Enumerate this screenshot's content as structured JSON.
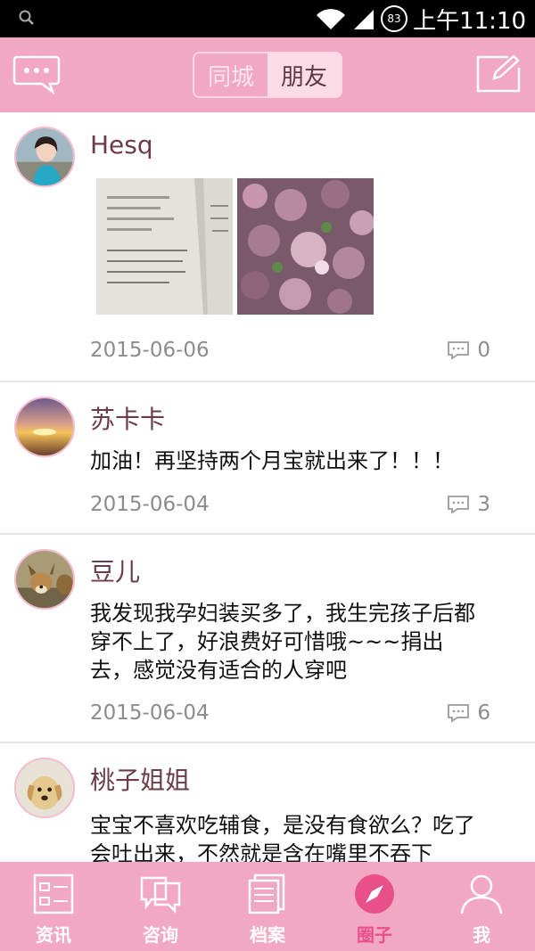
{
  "status_bar": {
    "battery": "83",
    "time": "上午11:10"
  },
  "header": {
    "tabs": [
      {
        "label": "同城",
        "active": false
      },
      {
        "label": "朋友",
        "active": true
      }
    ],
    "left_icon": "chat-bubble-icon",
    "right_icon": "compose-icon"
  },
  "posts": [
    {
      "name": "Hesq",
      "text": "",
      "photo_count": 2,
      "date": "2015-06-06",
      "comments": "0"
    },
    {
      "name": "苏卡卡",
      "text": "加油！再坚持两个月宝就出来了！！！",
      "date": "2015-06-04",
      "comments": "3"
    },
    {
      "name": "豆儿",
      "text_lines": [
        "我发现我孕妇装买多了，我生完孩子后都",
        "穿不上了，好浪费好可惜哦~~~捐出",
        "去，感觉没有适合的人穿吧"
      ],
      "date": "2015-06-04",
      "comments": "6"
    },
    {
      "name": "桃子姐姐",
      "text_lines": [
        "宝宝不喜欢吃辅食，是没有食欲么？吃了",
        "会吐出来，不然就是含在嘴里不吞下"
      ],
      "date": "",
      "comments": ""
    }
  ],
  "tabbar": {
    "items": [
      {
        "label": "资讯",
        "icon": "news-icon",
        "active": false
      },
      {
        "label": "咨询",
        "icon": "consult-icon",
        "active": false
      },
      {
        "label": "档案",
        "icon": "archive-icon",
        "active": false
      },
      {
        "label": "圈子",
        "icon": "compass-icon",
        "active": true
      },
      {
        "label": "我",
        "icon": "profile-icon",
        "active": false
      }
    ]
  },
  "colors": {
    "brand_pink": "#f2a7c3",
    "active_pink": "#e8508a",
    "name_color": "#6b3c48"
  }
}
